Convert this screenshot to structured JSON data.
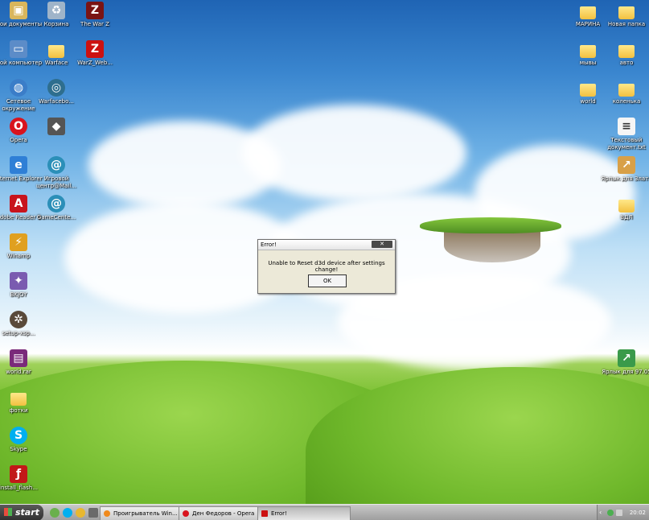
{
  "desktop": {
    "left_icons": [
      {
        "label": "Мои документы",
        "icon": "documents-icon"
      },
      {
        "label": "Корзина",
        "icon": "recycle-bin-icon"
      },
      {
        "label": "The War Z",
        "icon": "warz-icon"
      },
      {
        "label": "Мой компьютер",
        "icon": "computer-icon"
      },
      {
        "label": "Warface",
        "icon": "folder-icon"
      },
      {
        "label": "WarZ_Web...",
        "icon": "warz-web-icon"
      },
      {
        "label": "Сетевое окружение",
        "icon": "network-icon"
      },
      {
        "label": "Warfacebo...",
        "icon": "app-icon"
      },
      {
        "label": "Opera",
        "icon": "opera-icon"
      },
      {
        "label": "Internet Explorer",
        "icon": "ie-icon"
      },
      {
        "label": "Игровой центр@Mail...",
        "icon": "game-center-icon"
      },
      {
        "label": "Adobe Reader 9",
        "icon": "adobe-reader-icon"
      },
      {
        "label": "GameCente...",
        "icon": "game-center-icon"
      },
      {
        "label": "Winamp",
        "icon": "winamp-icon"
      },
      {
        "label": "BKJOY",
        "icon": "app-icon"
      },
      {
        "label": "setup-xsp...",
        "icon": "setup-icon"
      },
      {
        "label": "world.rar",
        "icon": "winrar-icon"
      },
      {
        "label": "фотки",
        "icon": "folder-icon"
      },
      {
        "label": "Skype",
        "icon": "skype-icon"
      },
      {
        "label": "install_flash...",
        "icon": "flash-icon"
      }
    ],
    "right_icons": [
      {
        "label": "МАРИНА",
        "icon": "folder-icon"
      },
      {
        "label": "Новая папка",
        "icon": "folder-icon"
      },
      {
        "label": "мывы",
        "icon": "folder-icon"
      },
      {
        "label": "авто",
        "icon": "folder-icon"
      },
      {
        "label": "world",
        "icon": "folder-icon"
      },
      {
        "label": "коленька",
        "icon": "folder-icon"
      },
      {
        "label": "Текстовый документ.txt",
        "icon": "text-file-icon"
      },
      {
        "label": "Ярлык для Злата",
        "icon": "shortcut-icon"
      },
      {
        "label": "ВДЛ",
        "icon": "folder-icon"
      },
      {
        "label": "Ярлык для 97.05",
        "icon": "shortcut-icon"
      }
    ]
  },
  "dialog": {
    "title": "Error!",
    "close_label": "✕",
    "message": "Unable to Reset d3d device after settings change!",
    "ok_label": "OK"
  },
  "taskbar": {
    "start_label": "start",
    "tasks": [
      {
        "label": "Проигрыватель Win...",
        "icon": "media-player-icon"
      },
      {
        "label": "Ден Федоров - Opera",
        "icon": "opera-icon"
      },
      {
        "label": "Error!",
        "icon": "warz-icon"
      }
    ],
    "clock": "20:02"
  },
  "colors": {
    "taskbar": "#a8a8a8",
    "dialog_bg": "#ece9d8",
    "sky": "#3a86cf",
    "grass": "#6fb82b"
  }
}
